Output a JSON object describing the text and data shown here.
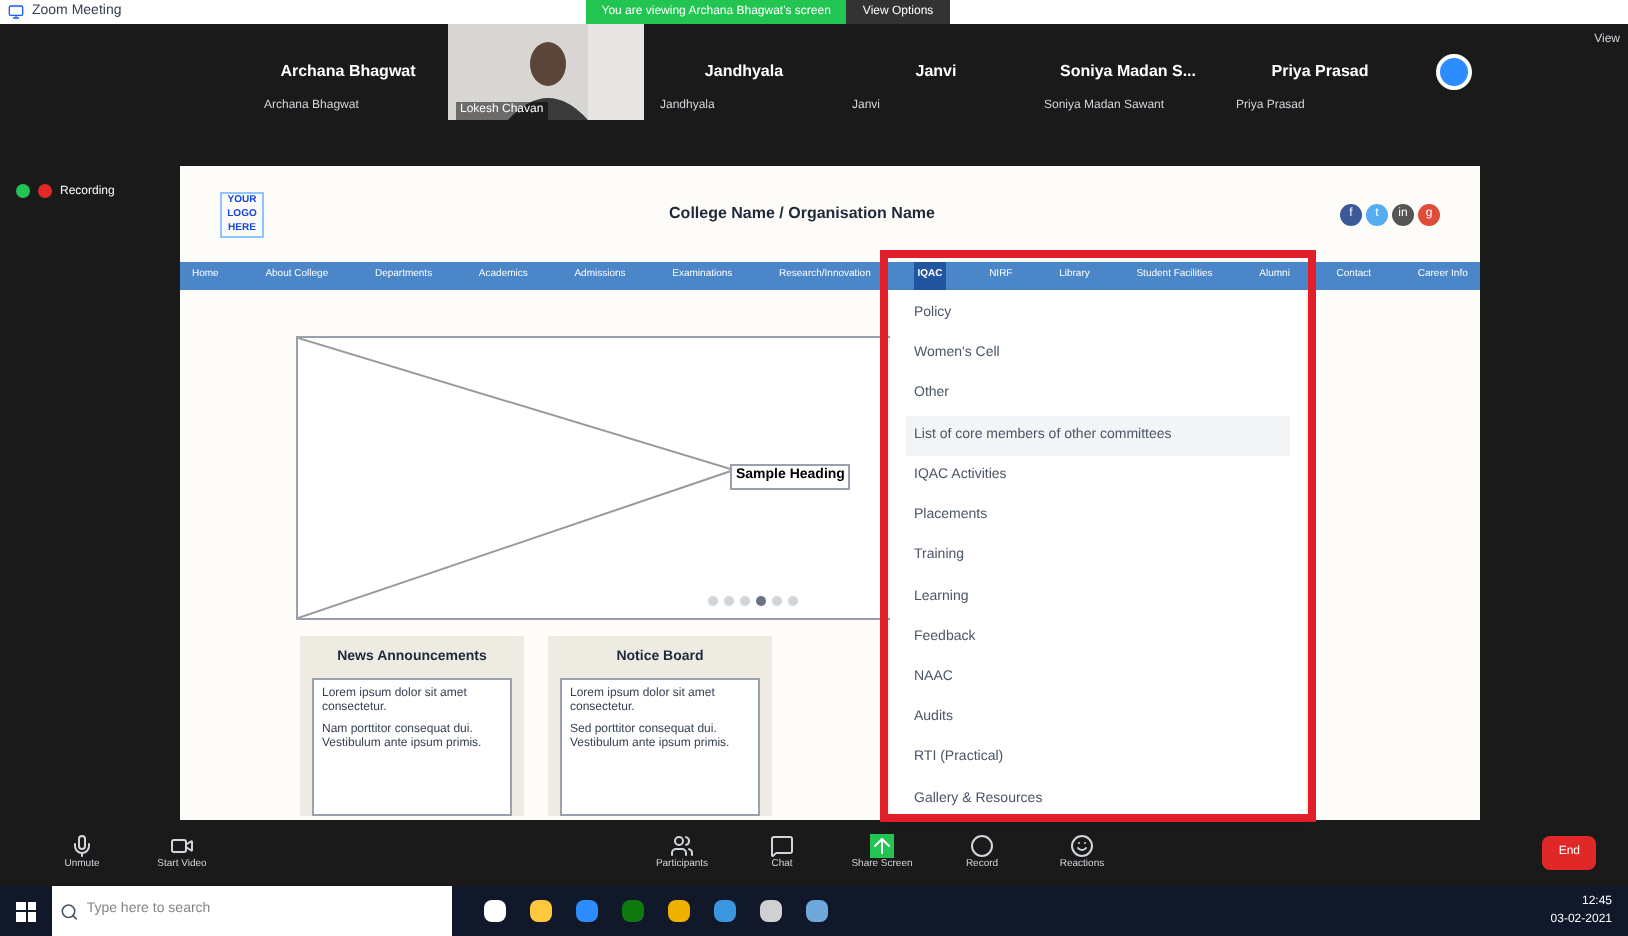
{
  "window": {
    "title": "Zoom Meeting"
  },
  "sharing_banner": "You are viewing Archana Bhagwat's screen",
  "view_options": "View Options",
  "participants": [
    {
      "name": "Archana Bhagwat",
      "label": "Archana Bhagwat",
      "kind": "name"
    },
    {
      "label": "Lokesh Chavan",
      "kind": "video"
    },
    {
      "name": "Jandhyala",
      "label": "Jandhyala",
      "kind": "name"
    },
    {
      "name": "Janvi",
      "label": "Janvi",
      "kind": "name"
    },
    {
      "name": "Soniya Madan S...",
      "label": "Soniya Madan Sawant",
      "kind": "name"
    },
    {
      "name": "Priya Prasad",
      "label": "Priya Prasad",
      "kind": "name"
    }
  ],
  "recording": "Recording",
  "gallery": "View",
  "webpage": {
    "logo": [
      "YOUR",
      "LOGO",
      "HERE"
    ],
    "title": "College Name / Organisation Name",
    "social": [
      {
        "glyph": "f",
        "color": "#3b5998"
      },
      {
        "glyph": "t",
        "color": "#55acee"
      },
      {
        "glyph": "in",
        "color": "#555555"
      },
      {
        "glyph": "g",
        "color": "#dd4b39"
      }
    ],
    "nav": [
      {
        "label": "Home",
        "selected": false
      },
      {
        "label": "About College",
        "selected": false
      },
      {
        "label": "Departments",
        "selected": false
      },
      {
        "label": "Academics",
        "selected": false
      },
      {
        "label": "Admissions",
        "selected": false
      },
      {
        "label": "Examinations",
        "selected": false
      },
      {
        "label": "Research/Innovation",
        "selected": false
      },
      {
        "label": "IQAC",
        "selected": true
      },
      {
        "label": "NIRF",
        "selected": false
      },
      {
        "label": "Library",
        "selected": false
      },
      {
        "label": "Student Facilities",
        "selected": false
      },
      {
        "label": "Alumni",
        "selected": false
      },
      {
        "label": "Contact",
        "selected": false
      },
      {
        "label": "Career Info",
        "selected": false
      }
    ],
    "dropdown": [
      {
        "label": "Policy",
        "selected": false
      },
      {
        "label": "Women's Cell",
        "selected": false
      },
      {
        "label": "Other",
        "selected": false
      },
      {
        "label": "List of core members of other committees",
        "selected": true
      },
      {
        "label": "IQAC Activities",
        "selected": false
      },
      {
        "label": "Placements",
        "selected": false
      },
      {
        "label": "Training",
        "selected": false
      },
      {
        "label": "Learning",
        "selected": false
      },
      {
        "label": "Feedback",
        "selected": false
      },
      {
        "label": "NAAC",
        "selected": false
      },
      {
        "label": "Audits",
        "selected": false
      },
      {
        "label": "RTI (Practical)",
        "selected": false
      },
      {
        "label": "Gallery & Resources",
        "selected": false
      }
    ],
    "slider": {
      "caption": "Sample Heading",
      "dots": [
        {
          "selected": false
        },
        {
          "selected": false
        },
        {
          "selected": false
        },
        {
          "selected": true
        },
        {
          "selected": false
        },
        {
          "selected": false
        }
      ]
    },
    "cards": [
      {
        "title": "News Announcements",
        "paragraphs": [
          "Lorem ipsum dolor sit amet consectetur.",
          "Nam porttitor consequat dui. Vestibulum ante ipsum primis."
        ]
      },
      {
        "title": "Notice Board",
        "paragraphs": [
          "Lorem ipsum dolor sit amet consectetur.",
          "Sed porttitor consequat dui. Vestibulum ante ipsum primis."
        ]
      }
    ]
  },
  "toolbar": [
    {
      "label": "Unmute",
      "kind": "mic"
    },
    {
      "label": "Start Video",
      "kind": "video"
    },
    {
      "label": "Participants",
      "kind": "people"
    },
    {
      "label": "Chat",
      "kind": "chat"
    },
    {
      "label": "Share Screen",
      "kind": "share"
    },
    {
      "label": "Record",
      "kind": "record"
    },
    {
      "label": "Reactions",
      "kind": "smile"
    }
  ],
  "end": "End",
  "taskbar": {
    "placeholder": "Type here to search",
    "time": "12:45",
    "date": "03-02-2021"
  }
}
